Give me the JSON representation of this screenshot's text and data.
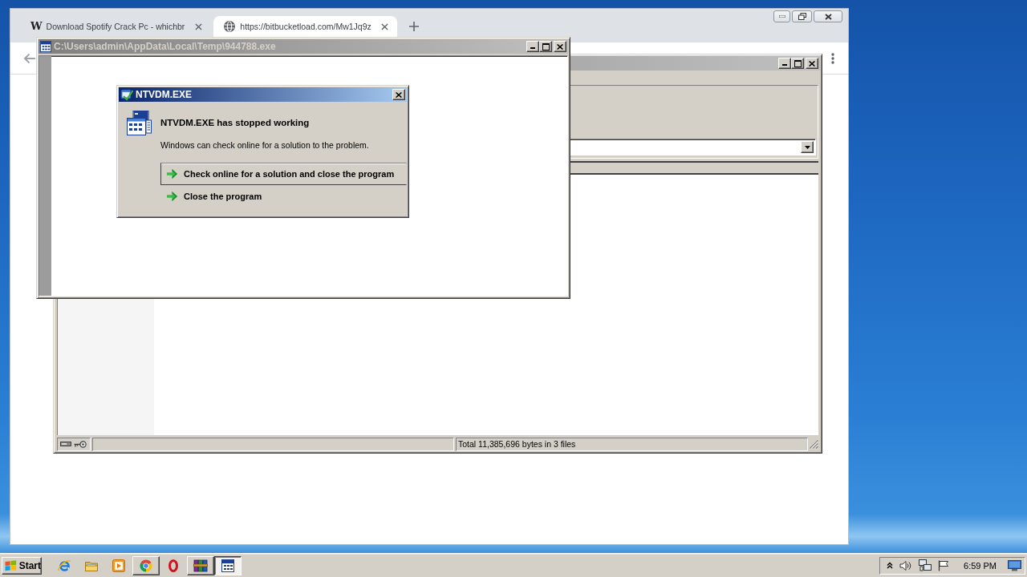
{
  "browser": {
    "tabs": [
      {
        "title": "Download Spotify Crack Pc - whichbr",
        "kind": "letter",
        "favicon": "W",
        "selected": false
      },
      {
        "title": "https://bitbucketload.com/Mw1Jq9z",
        "kind": "globe",
        "selected": true
      }
    ]
  },
  "file_window": {
    "status_bar": {
      "text": "Total 11,385,696 bytes in 3 files"
    }
  },
  "console_window": {
    "title": "C:\\Users\\admin\\AppData\\Local\\Temp\\944788.exe"
  },
  "error_dialog": {
    "title": "NTVDM.EXE",
    "heading": "NTVDM.EXE has stopped working",
    "message": "Windows can check online for a solution to the problem.",
    "options": [
      {
        "label": "Check online for a solution and close the program",
        "selected": true
      },
      {
        "label": "Close the program",
        "selected": false
      }
    ]
  },
  "taskbar": {
    "start": "Start",
    "apps": [
      {
        "kind": "e",
        "open": false,
        "selected": false
      },
      {
        "kind": "folder",
        "open": false,
        "selected": false
      },
      {
        "kind": "player",
        "open": false,
        "selected": false
      },
      {
        "kind": "wheel",
        "open": true,
        "selected": false
      },
      {
        "kind": "ring",
        "open": false,
        "selected": false
      },
      {
        "kind": "books",
        "open": true,
        "selected": false
      },
      {
        "kind": "console",
        "open": true,
        "selected": true
      }
    ],
    "clock": "6:59 PM"
  }
}
